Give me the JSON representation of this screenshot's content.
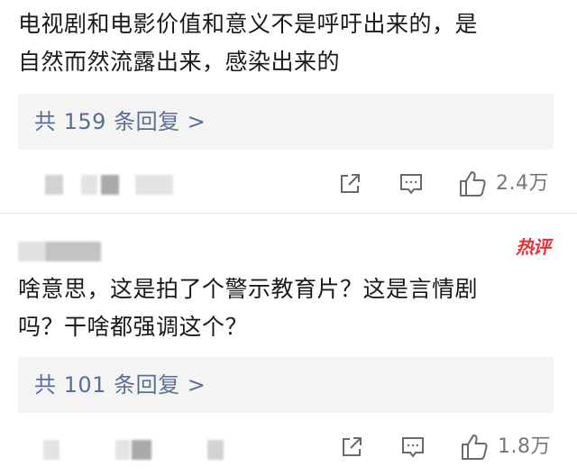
{
  "comment1": {
    "line1": "电视剧和电影价值和意义不是呼吁出来的，是",
    "line2": "自然而然流露出来，感染出来的",
    "reply_link": "共 159 条回复 >",
    "like_count": "2.4万"
  },
  "comment2": {
    "badge": "热评",
    "line1": "啥意思，这是拍了个警示教育片？这是言情剧",
    "line2": "吗？干啥都强调这个？",
    "reply_link": "共 101 条回复 >",
    "like_count": "1.8万"
  },
  "icons": {
    "share": "share-icon",
    "comment": "comment-icon",
    "like": "thumbs-up-icon"
  },
  "colors": {
    "link": "#5b6f94",
    "badge": "#e8323a",
    "reply_bg": "#f4f4f4"
  }
}
